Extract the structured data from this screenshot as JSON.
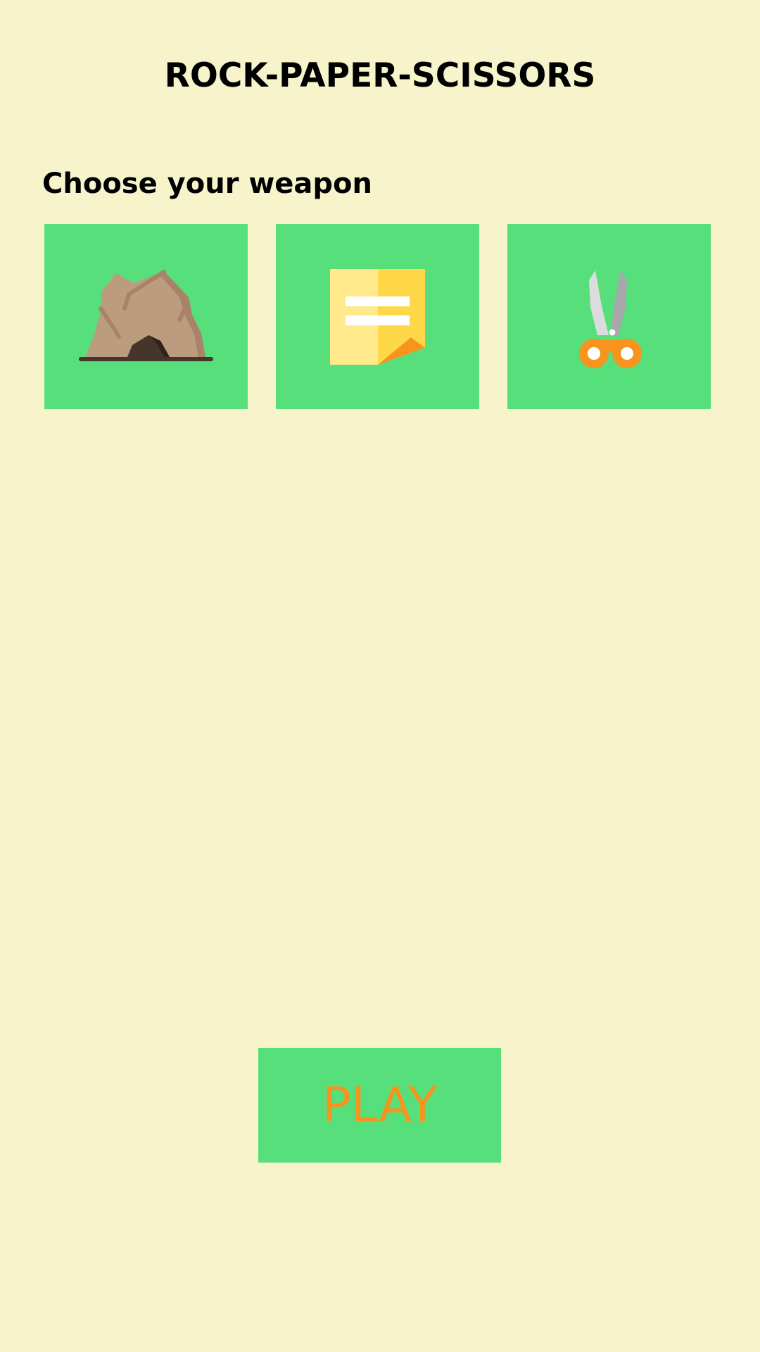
{
  "app": {
    "title": "ROCK-PAPER-SCISSORS",
    "prompt": "Choose your weapon"
  },
  "weapons": [
    {
      "id": "rock",
      "icon": "rock-icon"
    },
    {
      "id": "paper",
      "icon": "paper-icon"
    },
    {
      "id": "scissors",
      "icon": "scissors-icon"
    }
  ],
  "play": {
    "label": "PLAY"
  },
  "colors": {
    "background": "#f7f4cc",
    "tile": "#57df7c",
    "accent": "#f7941d",
    "text": "#000000"
  }
}
